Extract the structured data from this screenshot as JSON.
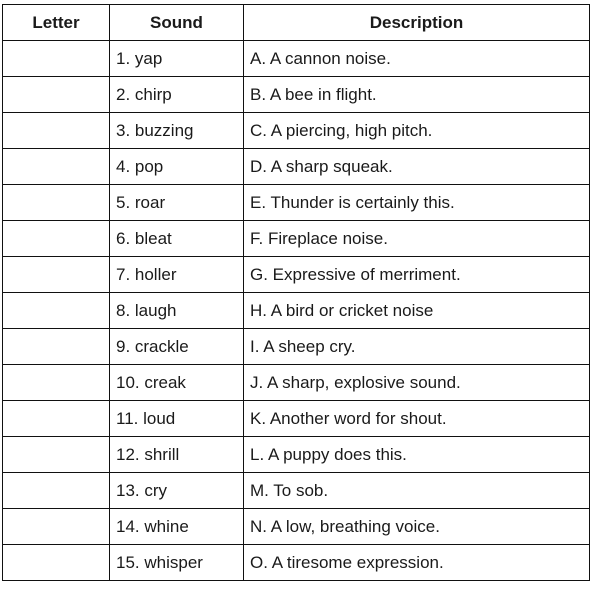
{
  "headers": [
    "Letter",
    "Sound",
    "Description"
  ],
  "rows": [
    {
      "letter": "",
      "sound": "1. yap",
      "description": "A. A cannon noise."
    },
    {
      "letter": "",
      "sound": "2. chirp",
      "description": "B. A bee in flight."
    },
    {
      "letter": "",
      "sound": "3. buzzing",
      "description": "C. A piercing, high pitch."
    },
    {
      "letter": "",
      "sound": "4. pop",
      "description": "D. A sharp squeak."
    },
    {
      "letter": "",
      "sound": "5. roar",
      "description": "E. Thunder is certainly this."
    },
    {
      "letter": "",
      "sound": "6. bleat",
      "description": "F. Fireplace noise."
    },
    {
      "letter": "",
      "sound": "7. holler",
      "description": "G. Expressive of merriment."
    },
    {
      "letter": "",
      "sound": "8. laugh",
      "description": "H. A bird or cricket noise"
    },
    {
      "letter": "",
      "sound": "9. crackle",
      "description": "I. A sheep cry."
    },
    {
      "letter": "",
      "sound": "10. creak",
      "description": "J. A sharp, explosive sound."
    },
    {
      "letter": "",
      "sound": "11. loud",
      "description": "K. Another word for shout."
    },
    {
      "letter": "",
      "sound": "12. shrill",
      "description": "L. A puppy does this."
    },
    {
      "letter": "",
      "sound": "13. cry",
      "description": "M. To sob."
    },
    {
      "letter": "",
      "sound": "14. whine",
      "description": "N. A low, breathing voice."
    },
    {
      "letter": "",
      "sound": "15. whisper",
      "description": "O. A tiresome expression."
    }
  ]
}
